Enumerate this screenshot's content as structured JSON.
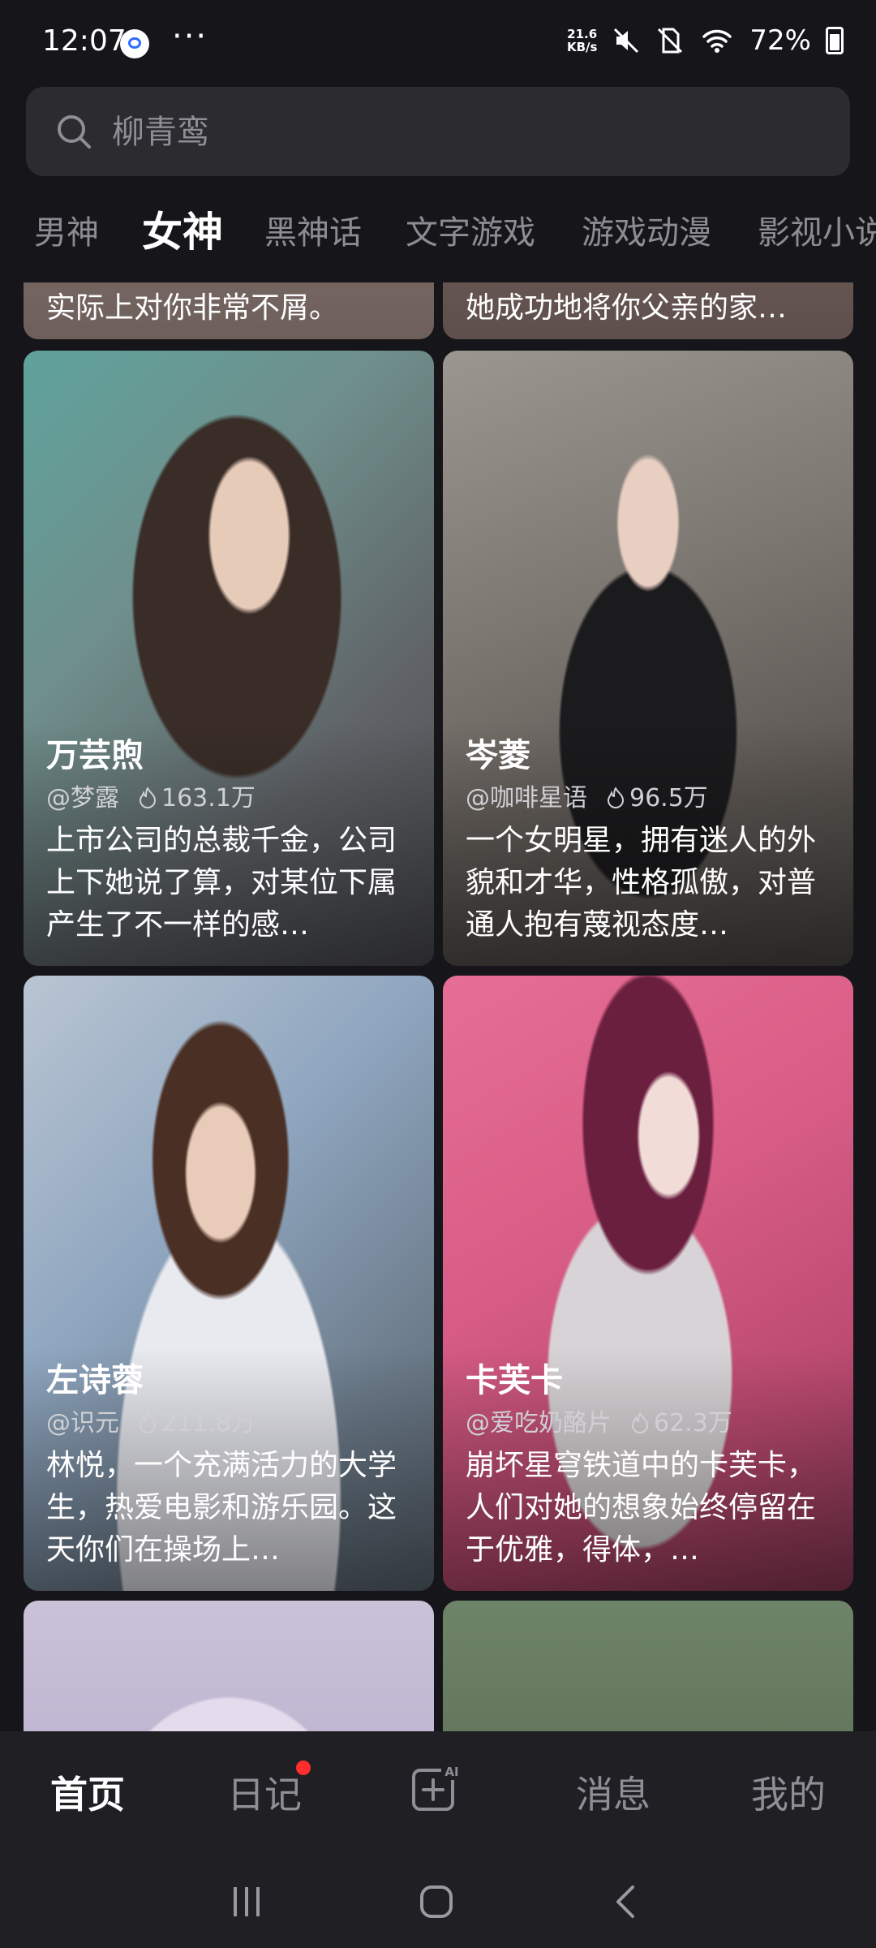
{
  "status_bar": {
    "time": "12:07",
    "more": "···",
    "net_speed_value": "21.6",
    "net_speed_unit": "KB/s",
    "battery": "72%"
  },
  "search": {
    "placeholder": "柳青鸾"
  },
  "tabs": [
    {
      "label": "男神",
      "active": false
    },
    {
      "label": "女神",
      "active": true
    },
    {
      "label": "黑神话",
      "active": false
    },
    {
      "label": "文字游戏",
      "active": false
    },
    {
      "label": "游戏动漫",
      "active": false
    },
    {
      "label": "影视小说",
      "active": false
    }
  ],
  "top_partial_cards": [
    {
      "desc": "实际上对你非常不屑。"
    },
    {
      "desc": "她成功地将你父亲的家…"
    }
  ],
  "cards": [
    {
      "name": "万芸煦",
      "author": "@梦露",
      "heat": "163.1万",
      "desc": "上市公司的总裁千金，公司上下她说了算，对某位下属产生了不一样的感…"
    },
    {
      "name": "岑菱",
      "author": "@咖啡星语",
      "heat": "96.5万",
      "desc": "一个女明星，拥有迷人的外貌和才华，性格孤傲，对普通人抱有蔑视态度…"
    },
    {
      "name": "左诗蓉",
      "author": "@识元",
      "heat": "211.8万",
      "desc": "林悦，一个充满活力的大学生，热爱电影和游乐园。这天你们在操场上…"
    },
    {
      "name": "卡芙卡",
      "author": "@爱吃奶酪片",
      "heat": "62.3万",
      "desc": "崩坏星穹铁道中的卡芙卡，人们对她的想象始终停留在于优雅，得体，…"
    }
  ],
  "bottom_nav": {
    "home": "首页",
    "diary": "日记",
    "create_badge": "AI",
    "messages": "消息",
    "me": "我的"
  },
  "colors": {
    "background": "#16161a",
    "search_bg": "#2b2b30",
    "nav_bg": "#1f1f24",
    "badge_red": "#ff2d2d"
  }
}
